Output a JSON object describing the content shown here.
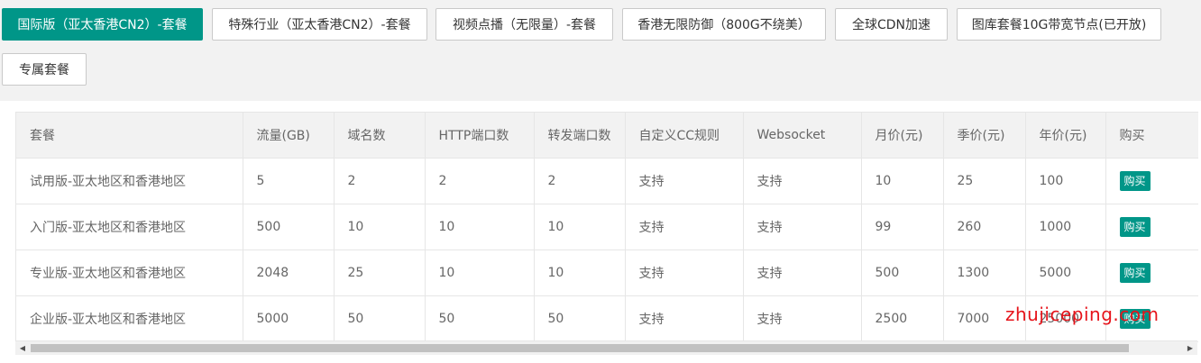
{
  "tabs": [
    {
      "label": "国际版（亚太香港CN2）-套餐",
      "active": true
    },
    {
      "label": "特殊行业（亚太香港CN2）-套餐",
      "active": false
    },
    {
      "label": "视频点播（无限量）-套餐",
      "active": false
    },
    {
      "label": "香港无限防御（800G不绕美）",
      "active": false
    },
    {
      "label": "全球CDN加速",
      "active": false
    },
    {
      "label": "图库套餐10G带宽节点(已开放)",
      "active": false
    },
    {
      "label": "专属套餐",
      "active": false
    }
  ],
  "table": {
    "headers": [
      "套餐",
      "流量(GB)",
      "域名数",
      "HTTP端口数",
      "转发端口数",
      "自定义CC规则",
      "Websocket",
      "月价(元)",
      "季价(元)",
      "年价(元)",
      "购买"
    ],
    "rows": [
      [
        "试用版-亚太地区和香港地区",
        "5",
        "2",
        "2",
        "2",
        "支持",
        "支持",
        "10",
        "25",
        "100"
      ],
      [
        "入门版-亚太地区和香港地区",
        "500",
        "10",
        "10",
        "10",
        "支持",
        "支持",
        "99",
        "260",
        "1000"
      ],
      [
        "专业版-亚太地区和香港地区",
        "2048",
        "25",
        "10",
        "10",
        "支持",
        "支持",
        "500",
        "1300",
        "5000"
      ],
      [
        "企业版-亚太地区和香港地区",
        "5000",
        "50",
        "50",
        "50",
        "支持",
        "支持",
        "2500",
        "7000",
        "25000"
      ]
    ],
    "buy_label": "购买"
  },
  "watermark": "zhujiceping.com",
  "colors": {
    "accent": "#009688",
    "watermark": "#e6141b"
  }
}
